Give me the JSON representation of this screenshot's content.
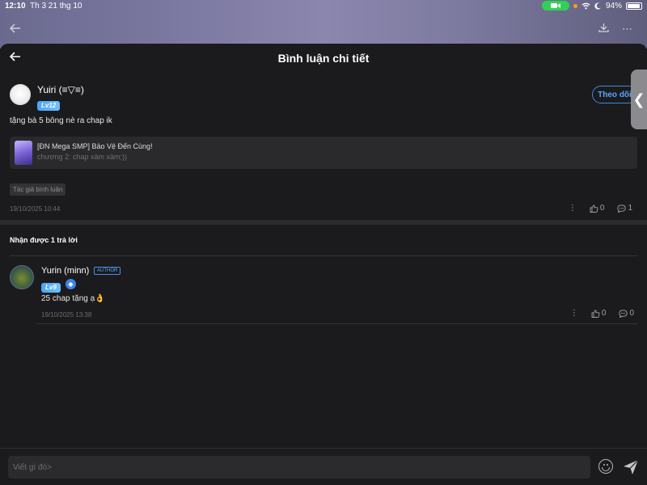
{
  "status_bar": {
    "time": "12:10",
    "date": "Th 3 21 thg 10",
    "battery": "94%"
  },
  "header": {
    "title": "Bình luận chi tiết"
  },
  "comment": {
    "user_name": "Yuiri (≡▽≡)",
    "level": "Lv12",
    "follow_label": "Theo dõi",
    "text": "tặng bà 5 bông nè ra chap ik",
    "story": {
      "title": "[ĐN Mega SMP] Bảo Vệ Đến Cùng!",
      "chapter": "chương 2: chap xàm xàm;))"
    },
    "author_tag": "Tác giả bình luận",
    "timestamp": "19/10/2025 10:44",
    "likes": "0",
    "replies": "1"
  },
  "replies_header": "Nhận được 1 trả lời",
  "reply": {
    "user_name": "Yurin (minn)",
    "author_badge": "AUTHOR",
    "level": "Lv9",
    "text": "25 chap tặng ạ👌",
    "timestamp": "19/10/2025 13:38",
    "likes": "0",
    "replies": "0"
  },
  "footer": {
    "input_placeholder": "Viết gì đó>"
  },
  "colors": {
    "accent": "#4a9bff",
    "background": "#1b1b1d",
    "card": "#2a2a2d"
  }
}
